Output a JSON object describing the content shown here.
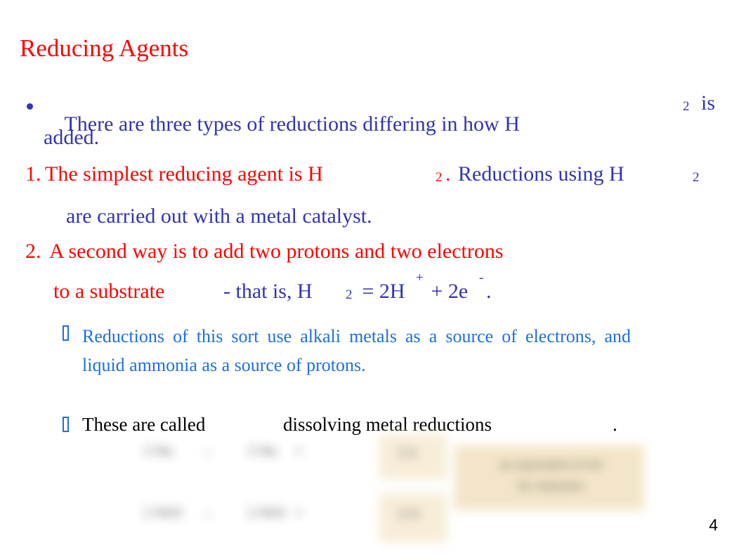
{
  "slide": {
    "title": "Reducing Agents",
    "page_number": "4",
    "colors": {
      "title_red": "#FF0000",
      "body_blue": "#3333B3",
      "sub_blue": "#1F6FE0",
      "black": "#000000",
      "tan": "#f2e3c4"
    }
  },
  "bullets": {
    "b1": {
      "line1_a": "There are three types of reductions differing in how H",
      "line1_sub": "2",
      "line1_b": "is",
      "line2": "added."
    },
    "b2": {
      "number": "1.",
      "text_a": "The simplest reducing agent is H",
      "sub_a": "2",
      "period": ".",
      "text_b": "Reductions using H",
      "sub_b": "2",
      "line2": "are carried out with a metal catalyst."
    },
    "b3": {
      "number": "2.",
      "text_a": "A second way is to add two protons and two electrons",
      "line2_red": "to a substrate",
      "line2_blue_a": "- that is, H",
      "line2_sub": "2",
      "line2_blue_b": " = 2H",
      "line2_sup1": "+",
      "line2_blue_c": " + 2e",
      "line2_sup2": "-",
      "line2_blue_d": "."
    },
    "b4": {
      "bullet_glyph": "tofu-box",
      "text": "Reductions of this sort use alkali metals as a source of electrons, and liquid ammonia as a source of protons."
    },
    "b5": {
      "bullet_glyph": "tofu-box",
      "text_a": "These are called",
      "text_red": "dissolving metal reductions",
      "text_b": "."
    }
  },
  "picture": {
    "caption": "blurred-chemical-equations-figure",
    "equation_row_1": "2 Na",
    "equation_row_1_arrow": "→",
    "equation_row_1_b": "2 Na",
    "equation_row_1_plus": "+",
    "equation_row_2": "2 NH3",
    "equation_row_2_arrow": "→",
    "equation_row_2_b": "2 NH2",
    "equation_row_2_plus": "+",
    "box_label_1": "2 e",
    "box_label_2": "2 H",
    "note_line_1": "an equivalent of H2",
    "note_line_2": "for reduction"
  }
}
